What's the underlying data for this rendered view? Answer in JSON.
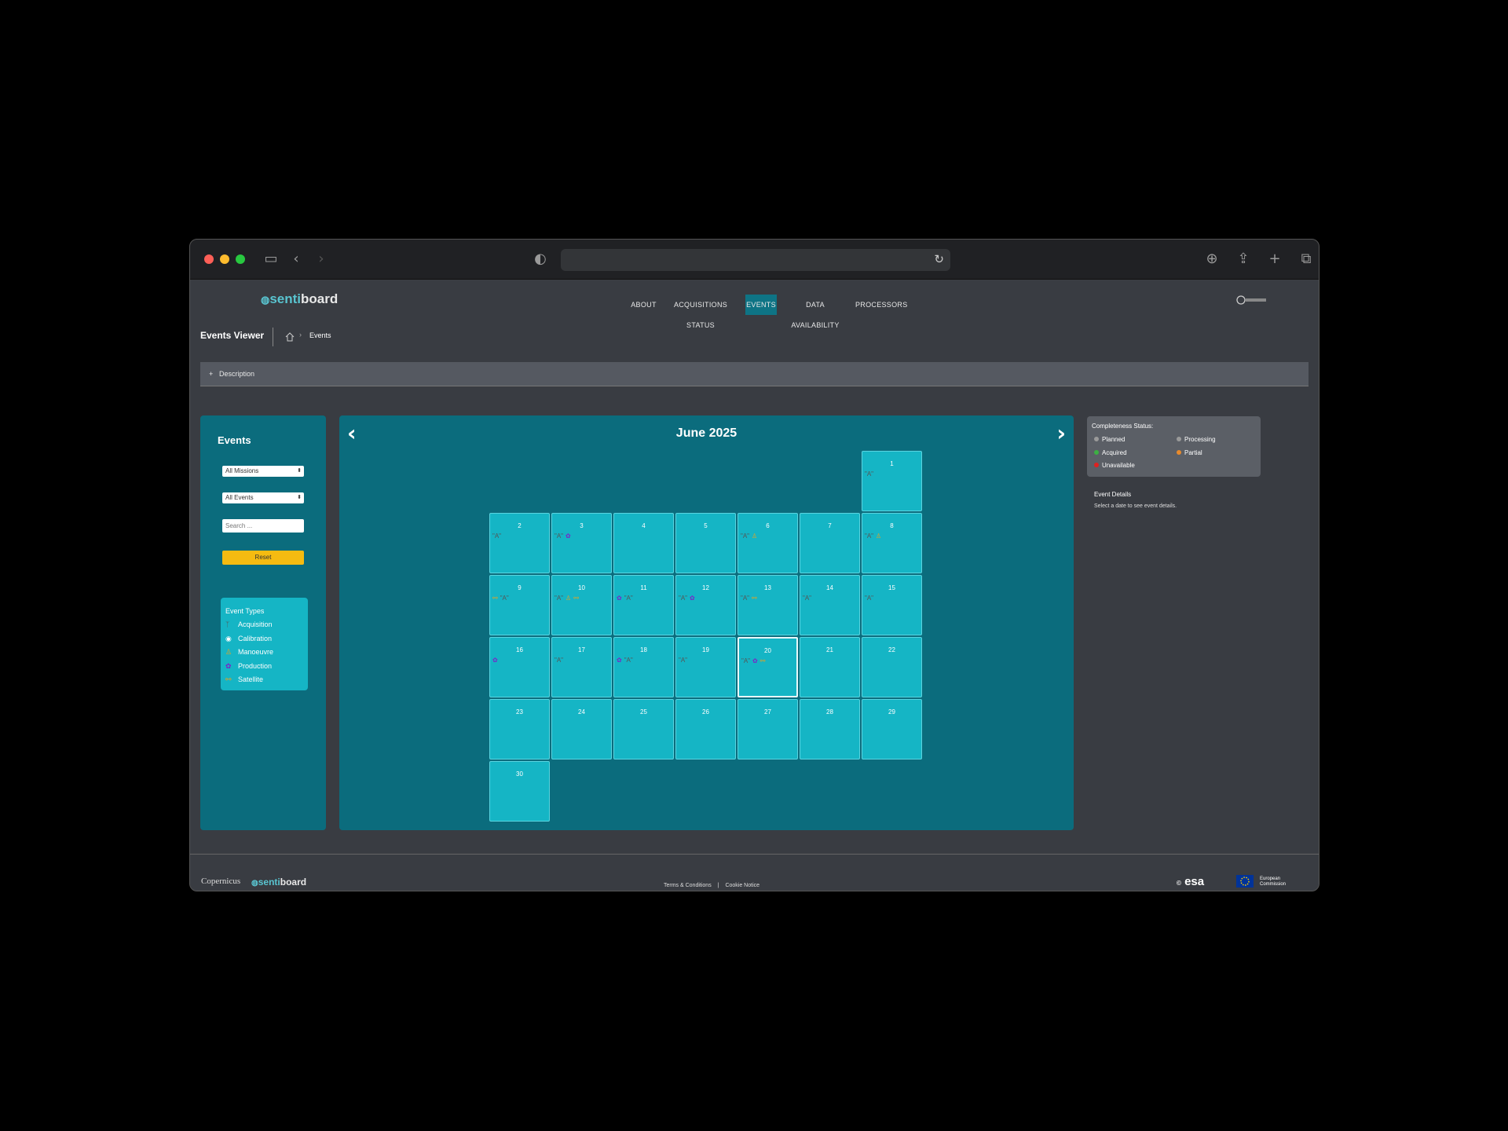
{
  "browser": {
    "traffic_colors": [
      "#fe5f57",
      "#febc2e",
      "#28c840"
    ]
  },
  "nav": {
    "logo": {
      "part1": "senti",
      "part2": "board"
    },
    "items": [
      "ABOUT",
      "ACQUISITIONS STATUS",
      "EVENTS",
      "DATA AVAILABILITY",
      "PROCESSORS"
    ],
    "active": "EVENTS"
  },
  "page": {
    "title": "Events Viewer",
    "breadcrumb": "Events",
    "description_toggle": "+",
    "description_label": "Description"
  },
  "filters": {
    "heading": "Events",
    "mission_select": "All Missions",
    "event_select": "All Events",
    "search_placeholder": "Search ...",
    "reset_label": "Reset"
  },
  "event_types": {
    "heading": "Event Types",
    "items": [
      {
        "icon": "acquisition-icon",
        "label": "Acquisition"
      },
      {
        "icon": "calibration-icon",
        "label": "Calibration"
      },
      {
        "icon": "manoeuvre-icon",
        "label": "Manoeuvre"
      },
      {
        "icon": "production-icon",
        "label": "Production"
      },
      {
        "icon": "satellite-icon",
        "label": "Satellite"
      }
    ]
  },
  "calendar": {
    "month": "June 2025",
    "selected_day": 20,
    "days": [
      {
        "d": 1,
        "ev": [
          "acq"
        ]
      },
      {
        "d": 2,
        "ev": [
          "acq"
        ]
      },
      {
        "d": 3,
        "ev": [
          "acq",
          "prod"
        ]
      },
      {
        "d": 4,
        "ev": []
      },
      {
        "d": 5,
        "ev": []
      },
      {
        "d": 6,
        "ev": [
          "acq",
          "man"
        ]
      },
      {
        "d": 7,
        "ev": []
      },
      {
        "d": 8,
        "ev": [
          "acq",
          "man"
        ]
      },
      {
        "d": 9,
        "ev": [
          "sat",
          "acq"
        ]
      },
      {
        "d": 10,
        "ev": [
          "acq",
          "man",
          "sat"
        ]
      },
      {
        "d": 11,
        "ev": [
          "prod",
          "acq"
        ]
      },
      {
        "d": 12,
        "ev": [
          "acq",
          "prod"
        ]
      },
      {
        "d": 13,
        "ev": [
          "acq",
          "sat"
        ]
      },
      {
        "d": 14,
        "ev": [
          "acq"
        ]
      },
      {
        "d": 15,
        "ev": [
          "acq"
        ]
      },
      {
        "d": 16,
        "ev": [
          "prod"
        ]
      },
      {
        "d": 17,
        "ev": [
          "acq"
        ]
      },
      {
        "d": 18,
        "ev": [
          "prod",
          "acq"
        ]
      },
      {
        "d": 19,
        "ev": [
          "acq"
        ]
      },
      {
        "d": 20,
        "ev": [
          "acq",
          "prod",
          "sat"
        ]
      },
      {
        "d": 21,
        "ev": []
      },
      {
        "d": 22,
        "ev": []
      },
      {
        "d": 23,
        "ev": []
      },
      {
        "d": 24,
        "ev": []
      },
      {
        "d": 25,
        "ev": []
      },
      {
        "d": 26,
        "ev": []
      },
      {
        "d": 27,
        "ev": []
      },
      {
        "d": 28,
        "ev": []
      },
      {
        "d": 29,
        "ev": []
      },
      {
        "d": 30,
        "ev": []
      }
    ]
  },
  "completeness": {
    "heading": "Completeness Status:",
    "items": [
      {
        "label": "Planned",
        "color": "#9a9a9a"
      },
      {
        "label": "Processing",
        "color": "#9a9a9a"
      },
      {
        "label": "Acquired",
        "color": "#3cb043"
      },
      {
        "label": "Partial",
        "color": "#e88a2c"
      },
      {
        "label": "Unavailable",
        "color": "#e02020"
      }
    ]
  },
  "event_details": {
    "heading": "Event Details",
    "hint": "Select a date to see event details."
  },
  "footer": {
    "logo_copernicus": "Copernicus",
    "logo_sentiboard": {
      "part1": "senti",
      "part2": "board"
    },
    "terms": "Terms & Conditions",
    "sep": "|",
    "cookie": "Cookie Notice",
    "esa": "esa",
    "ec": "European Commission"
  }
}
